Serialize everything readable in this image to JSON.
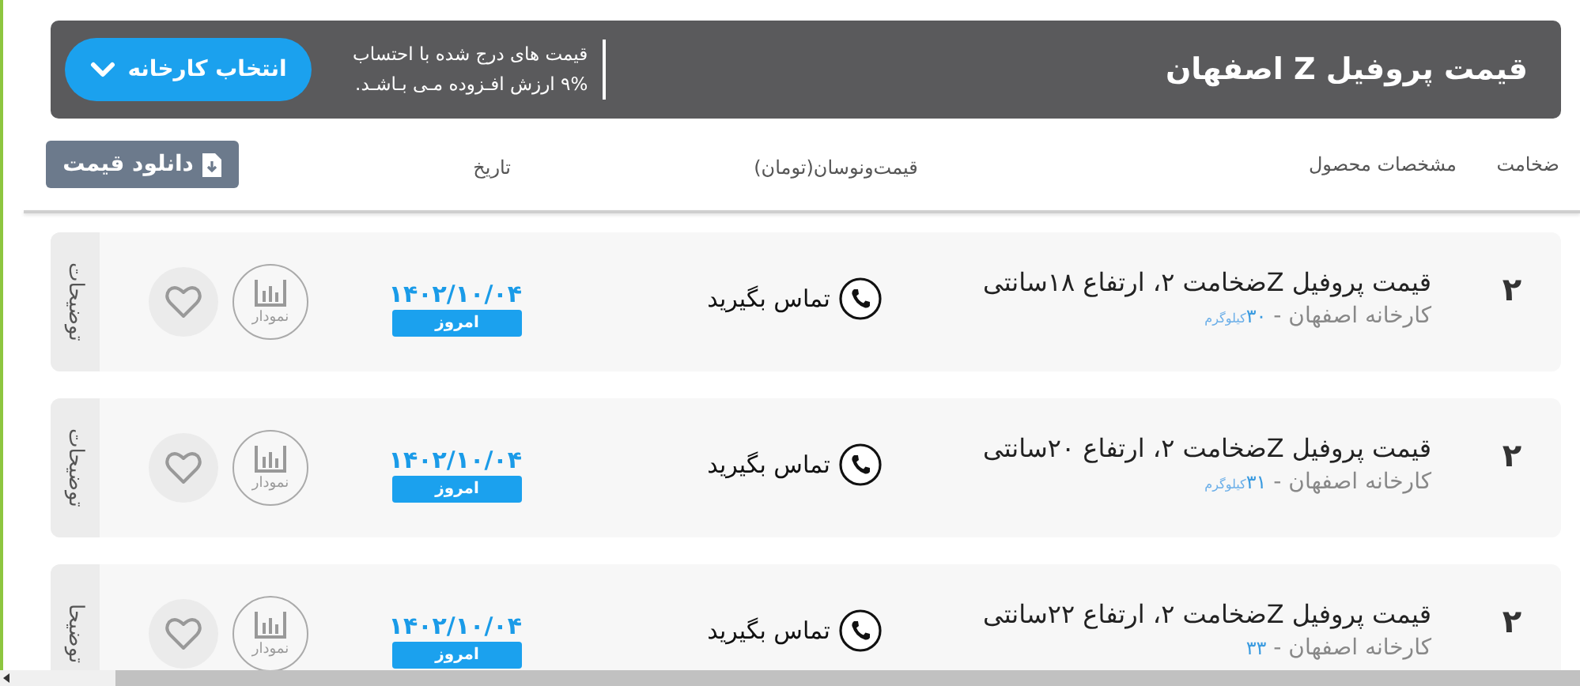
{
  "header": {
    "title": "قیمت پروفیل Z اصفهان",
    "note_lines": [
      "قیمت های درج شده با احتساب",
      "۹% ارزش افـزوده مـی بـاشـد."
    ],
    "factory_button": "انتخاب کارخانه"
  },
  "columns": [
    "ضخامت",
    "مشخصات محصول",
    "قیمت‌ونوسان(تومان)",
    "تاریخ"
  ],
  "download_button": "دانلود قیمت",
  "rows": [
    {
      "thickness": "۲",
      "title": "قیمت پروفیل Zضخامت ۲، ارتفاع ۱۸سانتی",
      "factory": "کارخانه اصفهان - ",
      "weight": "۳۰",
      "unit": "کیلوگرم",
      "price": "تماس بگیرید",
      "date": "۱۴۰۲/۱۰/۰۴",
      "date_badge": "امروز",
      "chart_label": "نمودار",
      "notes_tab": "توضیحات"
    },
    {
      "thickness": "۲",
      "title": "قیمت پروفیل Zضخامت ۲، ارتفاع ۲۰سانتی",
      "factory": "کارخانه اصفهان - ",
      "weight": "۳۱",
      "unit": "کیلوگرم",
      "price": "تماس بگیرید",
      "date": "۱۴۰۲/۱۰/۰۴",
      "date_badge": "امروز",
      "chart_label": "نمودار",
      "notes_tab": "توضیحات"
    },
    {
      "thickness": "۲",
      "title": "قیمت پروفیل Zضخامت ۲، ارتفاع ۲۲سانتی",
      "factory": "کارخانه اصفهان - ",
      "weight": "۳۳",
      "price": "تماس بگیرید",
      "date": "۱۴۰۲/۱۰/۰۴",
      "date_badge": "امروز",
      "chart_label": "نمودار",
      "notes_tab": "توضیحا"
    }
  ]
}
